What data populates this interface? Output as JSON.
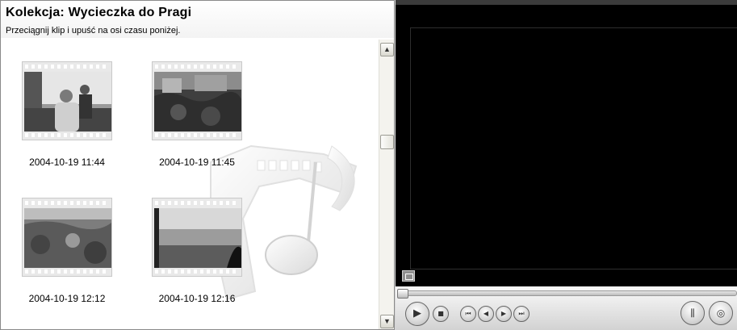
{
  "collection": {
    "title": "Kolekcja: Wycieczka do Pragi",
    "subtitle": "Przeciągnij klip i upuść na osi czasu poniżej.",
    "clips": [
      {
        "label": "2004-10-19 11:44"
      },
      {
        "label": "2004-10-19 11:45"
      },
      {
        "label": "2004-10-19 12:12"
      },
      {
        "label": "2004-10-19 12:16"
      }
    ]
  },
  "scrollbar": {
    "up_icon": "scroll-up-arrow",
    "down_icon": "scroll-down-arrow"
  },
  "player": {
    "controls": [
      "play-icon",
      "stop-icon",
      "previous-frame-icon",
      "rewind-icon",
      "fast-forward-icon",
      "next-frame-icon",
      "split-clip-icon",
      "take-picture-icon"
    ],
    "seek_position": 0
  },
  "colors": {
    "screen": "#000000",
    "panel": "#d6d6d6",
    "header_text": "#000000"
  }
}
